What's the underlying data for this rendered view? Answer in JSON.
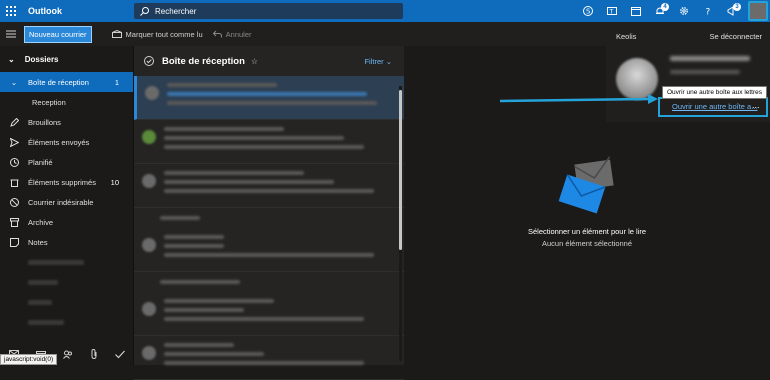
{
  "app": {
    "name": "Outlook"
  },
  "search": {
    "placeholder": "Rechercher"
  },
  "topbar": {
    "notifications_badge": "4",
    "feedback_badge": "3"
  },
  "commandbar": {
    "new_mail": "Nouveau courrier",
    "mark_all_read": "Marquer tout comme lu",
    "undo": "Annuler"
  },
  "sidebar": {
    "folders_header": "Dossiers",
    "items": [
      {
        "label": "Boîte de réception",
        "count": "1",
        "icon": "inbox-icon"
      },
      {
        "label": "Reception",
        "count": "",
        "icon": ""
      },
      {
        "label": "Brouillons",
        "count": "",
        "icon": "pencil-icon"
      },
      {
        "label": "Éléments envoyés",
        "count": "",
        "icon": "send-icon"
      },
      {
        "label": "Planifié",
        "count": "",
        "icon": "clock-icon"
      },
      {
        "label": "Éléments supprimés",
        "count": "10",
        "icon": "trash-icon"
      },
      {
        "label": "Courrier indésirable",
        "count": "",
        "icon": "junk-icon"
      },
      {
        "label": "Archive",
        "count": "",
        "icon": "archive-icon"
      },
      {
        "label": "Notes",
        "count": "",
        "icon": "note-icon"
      }
    ],
    "status_url": "javascript:void(0)"
  },
  "list": {
    "title": "Boîte de réception",
    "filter": "Filtrer"
  },
  "reading": {
    "empty_title": "Sélectionner un élément pour le lire",
    "empty_sub": "Aucun élément sélectionné"
  },
  "account": {
    "org": "Keolis",
    "logout": "Se déconnecter",
    "tooltip": "Ouvrir une autre boîte aux lettres",
    "open_other": "Ouvrir une autre boîte a...",
    "more": "..."
  },
  "colors": {
    "accent": "#0f6cbd",
    "highlight": "#24a3d8"
  }
}
